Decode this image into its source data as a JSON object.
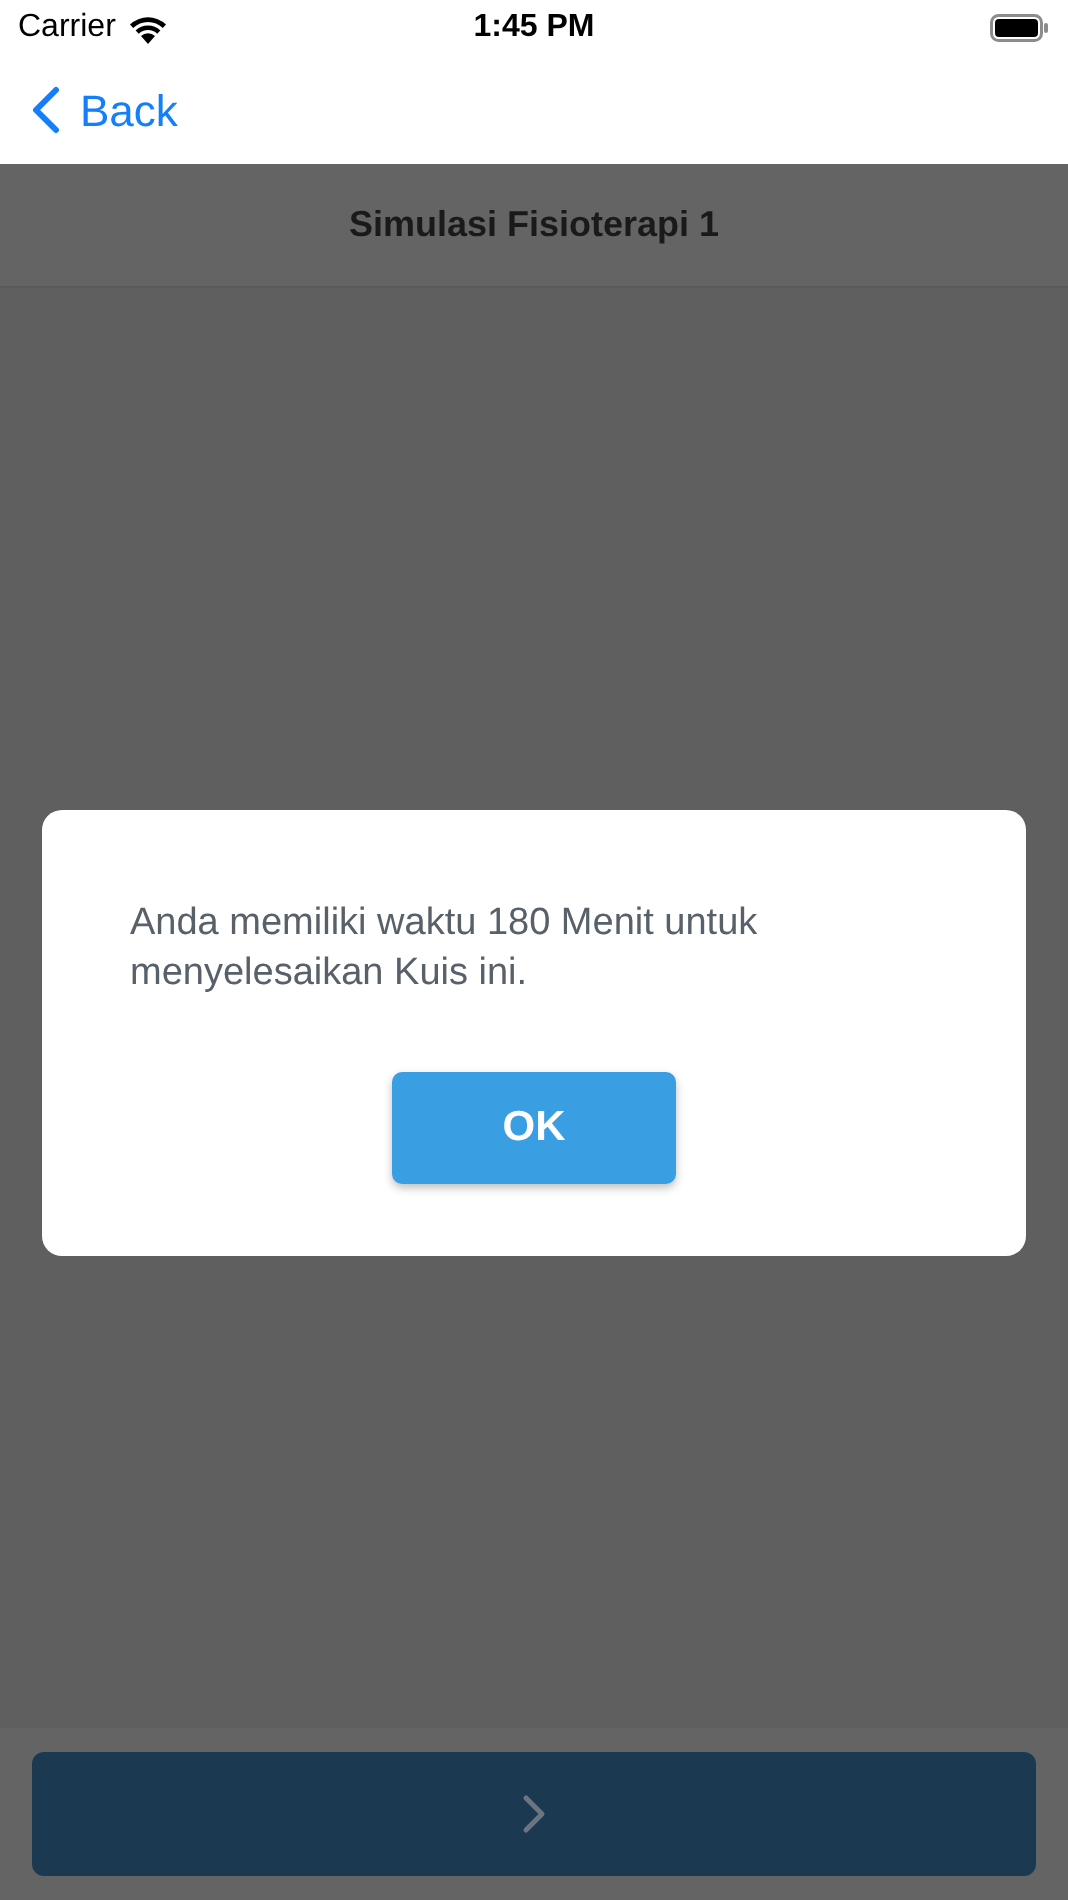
{
  "status_bar": {
    "carrier": "Carrier",
    "time": "1:45 PM"
  },
  "nav_bar": {
    "back_label": "Back"
  },
  "header": {
    "title": "Simulasi Fisioterapi 1"
  },
  "dialog": {
    "message": "Anda memiliki waktu 180 Menit untuk menyelesaikan Kuis ini.",
    "button": "OK"
  }
}
